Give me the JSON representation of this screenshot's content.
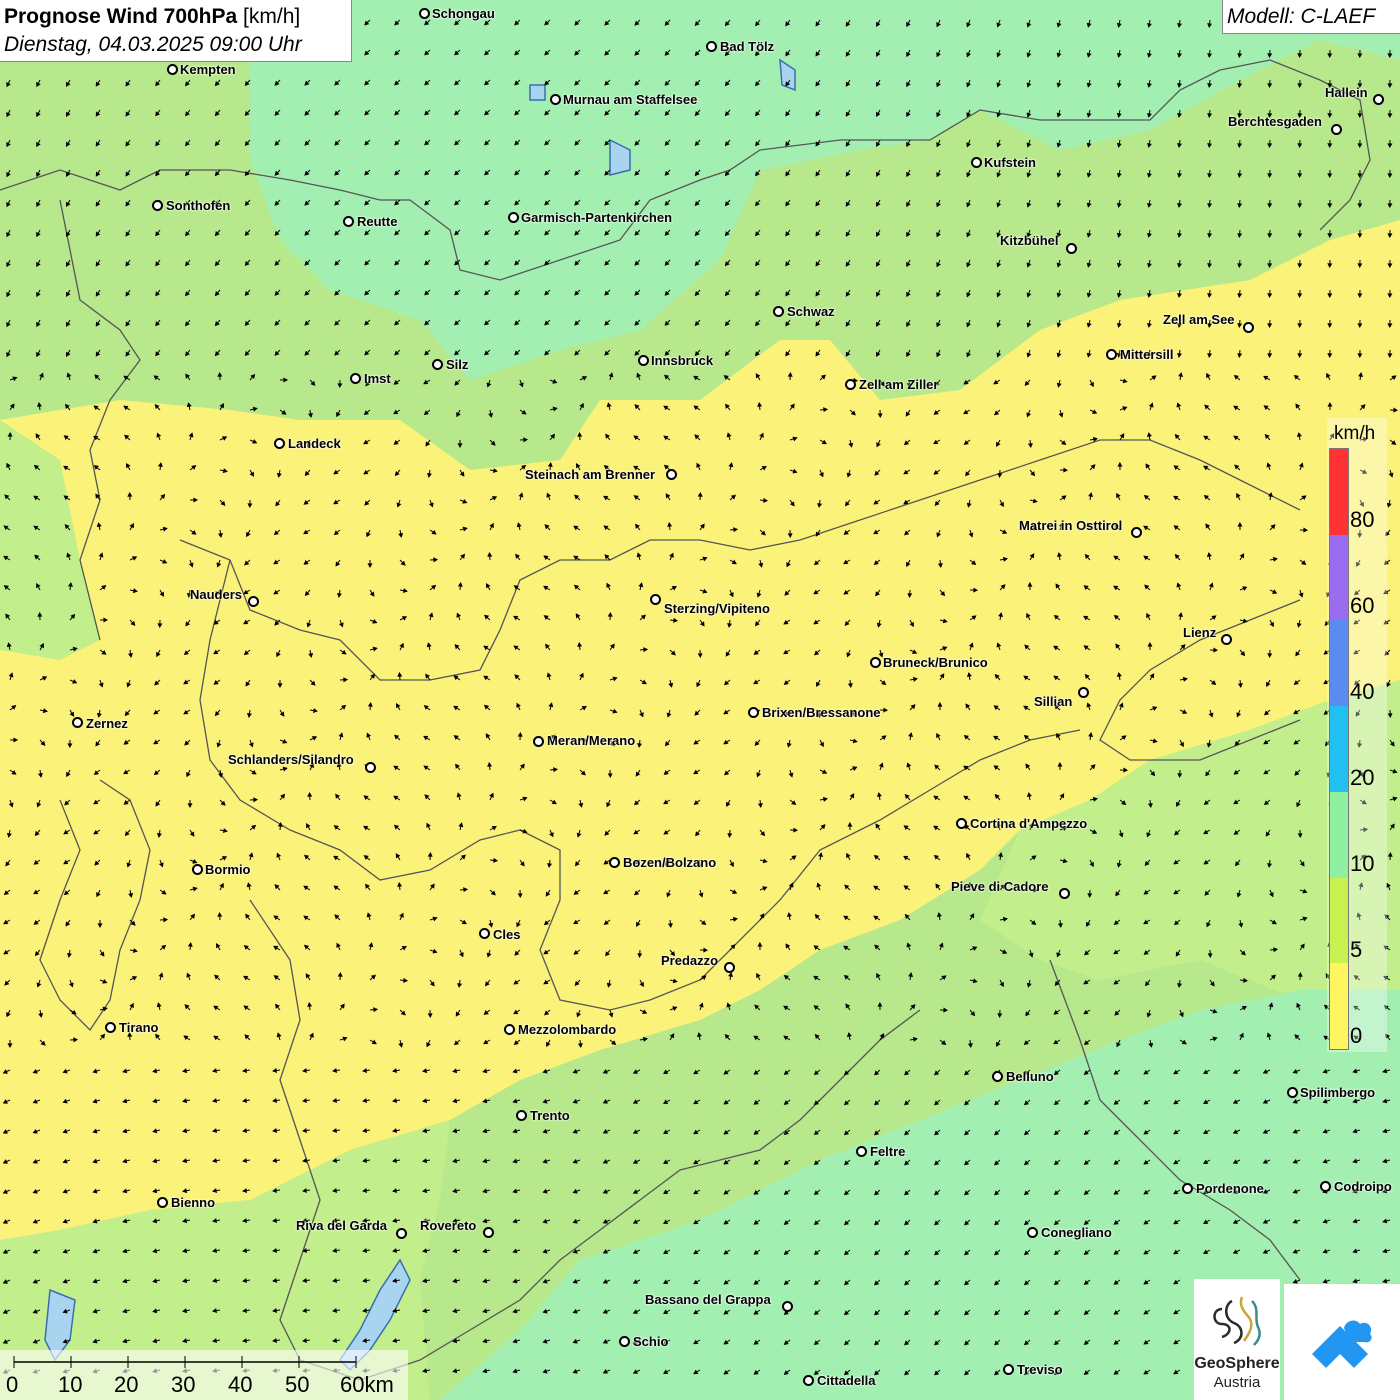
{
  "header": {
    "title_bold": "Prognose Wind 700hPa",
    "title_unit": "[km/h]",
    "datetime": "Dienstag, 04.03.2025 09:00 Uhr",
    "model": "Modell: C-LAEF"
  },
  "legend": {
    "unit": "km/h",
    "labels": [
      "80",
      "60",
      "40",
      "20",
      "10",
      "5",
      "0"
    ],
    "colors": [
      "#ff3333",
      "#9b6cf0",
      "#5a8cf0",
      "#22c0f0",
      "#8ef0a0",
      "#c8f050",
      "#fff560"
    ]
  },
  "scale": {
    "labels": [
      "0",
      "10",
      "20",
      "30",
      "40",
      "50",
      "60km"
    ]
  },
  "logo": {
    "brand_line1": "GeoSphere",
    "brand_line2": "Austria",
    "icons": [
      "geosphere-logo-icon",
      "weather-app-logo-icon"
    ]
  },
  "field_colors": {
    "calm": "#fbf27a",
    "light": "#c6ee86",
    "moderate": "#a6f0a8"
  },
  "cities": [
    {
      "name": "Schongau"
    },
    {
      "name": "Bad Tölz"
    },
    {
      "name": "Kempten"
    },
    {
      "name": "Murnau am Staffelsee"
    },
    {
      "name": "Hallein"
    },
    {
      "name": "Berchtesgaden"
    },
    {
      "name": "Kufstein"
    },
    {
      "name": "Sonthofen"
    },
    {
      "name": "Reutte"
    },
    {
      "name": "Garmisch-Partenkirchen"
    },
    {
      "name": "Kitzbühel"
    },
    {
      "name": "Schwaz"
    },
    {
      "name": "Zell am See"
    },
    {
      "name": "Mittersill"
    },
    {
      "name": "Innsbruck"
    },
    {
      "name": "Silz"
    },
    {
      "name": "Imst"
    },
    {
      "name": "Zell am Ziller"
    },
    {
      "name": "Landeck"
    },
    {
      "name": "Steinach am Brenner"
    },
    {
      "name": "Matrei in Osttirol"
    },
    {
      "name": "Nauders"
    },
    {
      "name": "Sterzing/Vipiteno"
    },
    {
      "name": "Lienz"
    },
    {
      "name": "Bruneck/Brunico"
    },
    {
      "name": "Sillian"
    },
    {
      "name": "Brixen/Bressanone"
    },
    {
      "name": "Zernez"
    },
    {
      "name": "Meran/Merano"
    },
    {
      "name": "Schlanders/Silandro"
    },
    {
      "name": "Cortina d'Ampezzo"
    },
    {
      "name": "Bozen/Bolzano"
    },
    {
      "name": "Bormio"
    },
    {
      "name": "Pieve di Cadore"
    },
    {
      "name": "Cles"
    },
    {
      "name": "Predazzo"
    },
    {
      "name": "Tirano"
    },
    {
      "name": "Mezzolombardo"
    },
    {
      "name": "Belluno"
    },
    {
      "name": "Spilimbergo"
    },
    {
      "name": "Trento"
    },
    {
      "name": "Feltre"
    },
    {
      "name": "Pordenone"
    },
    {
      "name": "Codroipo"
    },
    {
      "name": "Bienno"
    },
    {
      "name": "Riva del Garda"
    },
    {
      "name": "Rovereto"
    },
    {
      "name": "Conegliano"
    },
    {
      "name": "Bassano del Grappa"
    },
    {
      "name": "Schio"
    },
    {
      "name": "Treviso"
    },
    {
      "name": "Cittadella"
    }
  ]
}
